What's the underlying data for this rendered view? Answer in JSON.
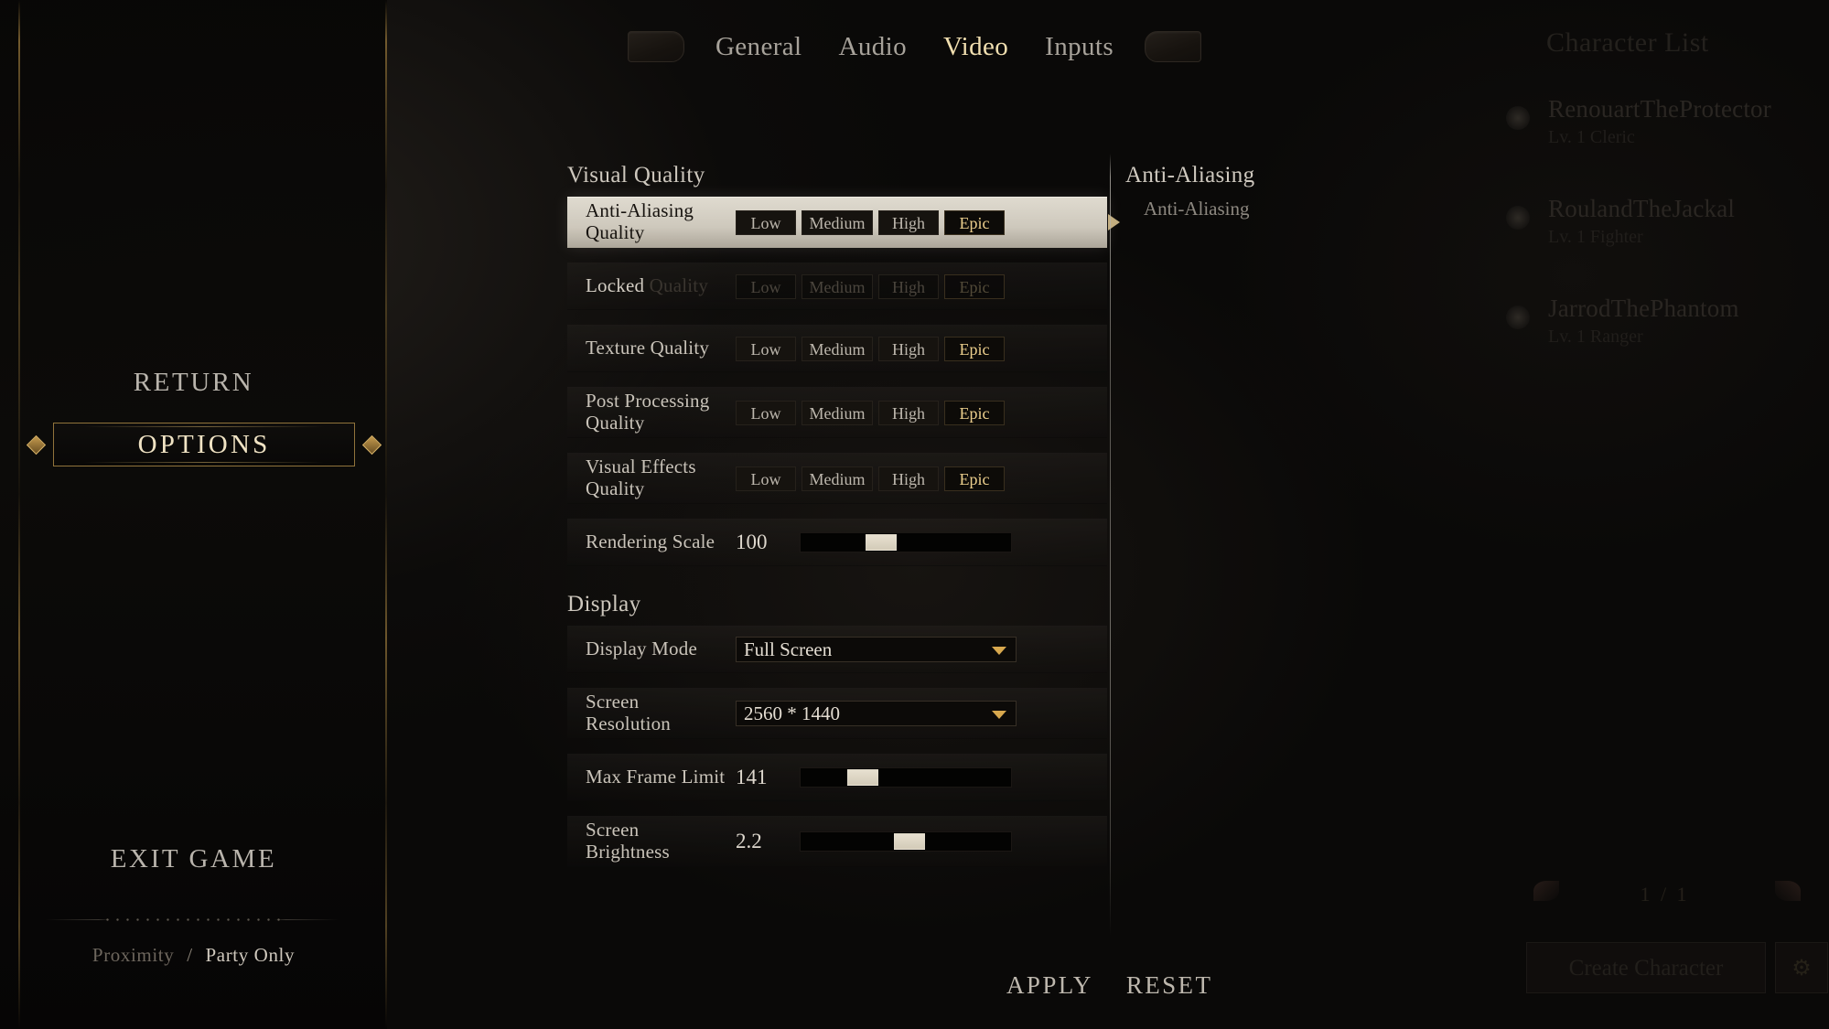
{
  "sidebar": {
    "return_label": "RETURN",
    "options_label": "OPTIONS",
    "exit_label": "EXIT GAME",
    "chat": {
      "proximity": "Proximity",
      "separator": "/",
      "party_only": "Party Only"
    }
  },
  "tabs": {
    "items": [
      {
        "label": "General",
        "active": false
      },
      {
        "label": "Audio",
        "active": false
      },
      {
        "label": "Video",
        "active": true
      },
      {
        "label": "Inputs",
        "active": false
      }
    ]
  },
  "settings": {
    "visual_quality_head": "Visual Quality",
    "display_head": "Display",
    "quality_options": [
      "Low",
      "Medium",
      "High",
      "Epic"
    ],
    "rows": {
      "anti_aliasing": {
        "label_line1": "Anti-Aliasing",
        "label_line2": "Quality",
        "selected": "Epic"
      },
      "locked": {
        "label_locked": "Locked",
        "label_ghost": "Quality",
        "selected": "Epic"
      },
      "texture": {
        "label": "Texture Quality",
        "selected": "Epic"
      },
      "post_processing": {
        "label_line1": "Post Processing",
        "label_line2": "Quality",
        "selected": "Epic"
      },
      "visual_effects": {
        "label_line1": "Visual Effects",
        "label_line2": "Quality",
        "selected": "Epic"
      },
      "rendering_scale": {
        "label": "Rendering Scale",
        "value": "100",
        "percent": 36
      },
      "display_mode": {
        "label": "Display Mode",
        "value": "Full Screen"
      },
      "screen_resolution": {
        "label_line1": "Screen",
        "label_line2": "Resolution",
        "value": "2560 * 1440"
      },
      "max_frame_limit": {
        "label": "Max Frame Limit",
        "value": "141",
        "percent": 26
      },
      "screen_brightness": {
        "label_line1": "Screen",
        "label_line2": "Brightness",
        "value": "2.2",
        "percent": 52
      }
    }
  },
  "description": {
    "title": "Anti-Aliasing",
    "body": "Anti-Aliasing"
  },
  "footer": {
    "apply_label": "APPLY",
    "reset_label": "RESET"
  },
  "background": {
    "character_list_title": "Character List",
    "characters": [
      {
        "name": "RenouartTheProtector",
        "sub": "Lv. 1 Cleric"
      },
      {
        "name": "RoulandTheJackal",
        "sub": "Lv. 1 Fighter"
      },
      {
        "name": "JarrodThePhantom",
        "sub": "Lv. 1 Ranger"
      }
    ],
    "paging": "1 / 1",
    "create_character": "Create Character",
    "gear_label": "⚙"
  },
  "colors": {
    "gold_accent": "#eccf8d",
    "gold_border": "#a88644",
    "dropdown_arrow": "#d8a84e",
    "text_primary": "#c9c3b9",
    "highlight_row_bg": "#ece7db"
  }
}
